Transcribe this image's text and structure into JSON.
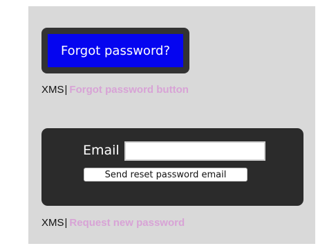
{
  "forgot_section": {
    "button_label": "Forgot password?",
    "caption_prefix": "XMS",
    "caption_separator": "|",
    "caption_link": "Forgot password button"
  },
  "request_section": {
    "email_label": "Email",
    "email_value": "",
    "send_button_label": "Send reset password email",
    "caption_prefix": "XMS",
    "caption_separator": "|",
    "caption_link": "Request new password"
  },
  "colors": {
    "panel_bg": "#d9d9d9",
    "forgot_button_bg": "#0505f0",
    "forgot_button_frame": "#333333",
    "email_card_bg": "#2b2b2b",
    "link_color": "#d8a3d6"
  }
}
